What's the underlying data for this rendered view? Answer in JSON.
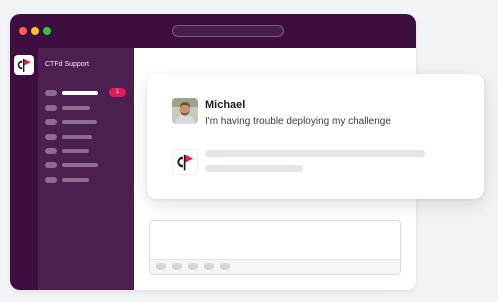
{
  "sidebar": {
    "workspace_name": "CTFd Support",
    "active_badge": "1"
  },
  "message": {
    "sender": "Michael",
    "text": "I'm having trouble deploying my challenge"
  },
  "colors": {
    "sidebar_bg": "#4d1f50",
    "titlebar_bg": "#3f0e40",
    "badge": "#e01e5a",
    "logo_red": "#e2263a"
  },
  "icons": {
    "app_logo": "ctfd-flag-logo",
    "user_avatar": "user-photo"
  }
}
